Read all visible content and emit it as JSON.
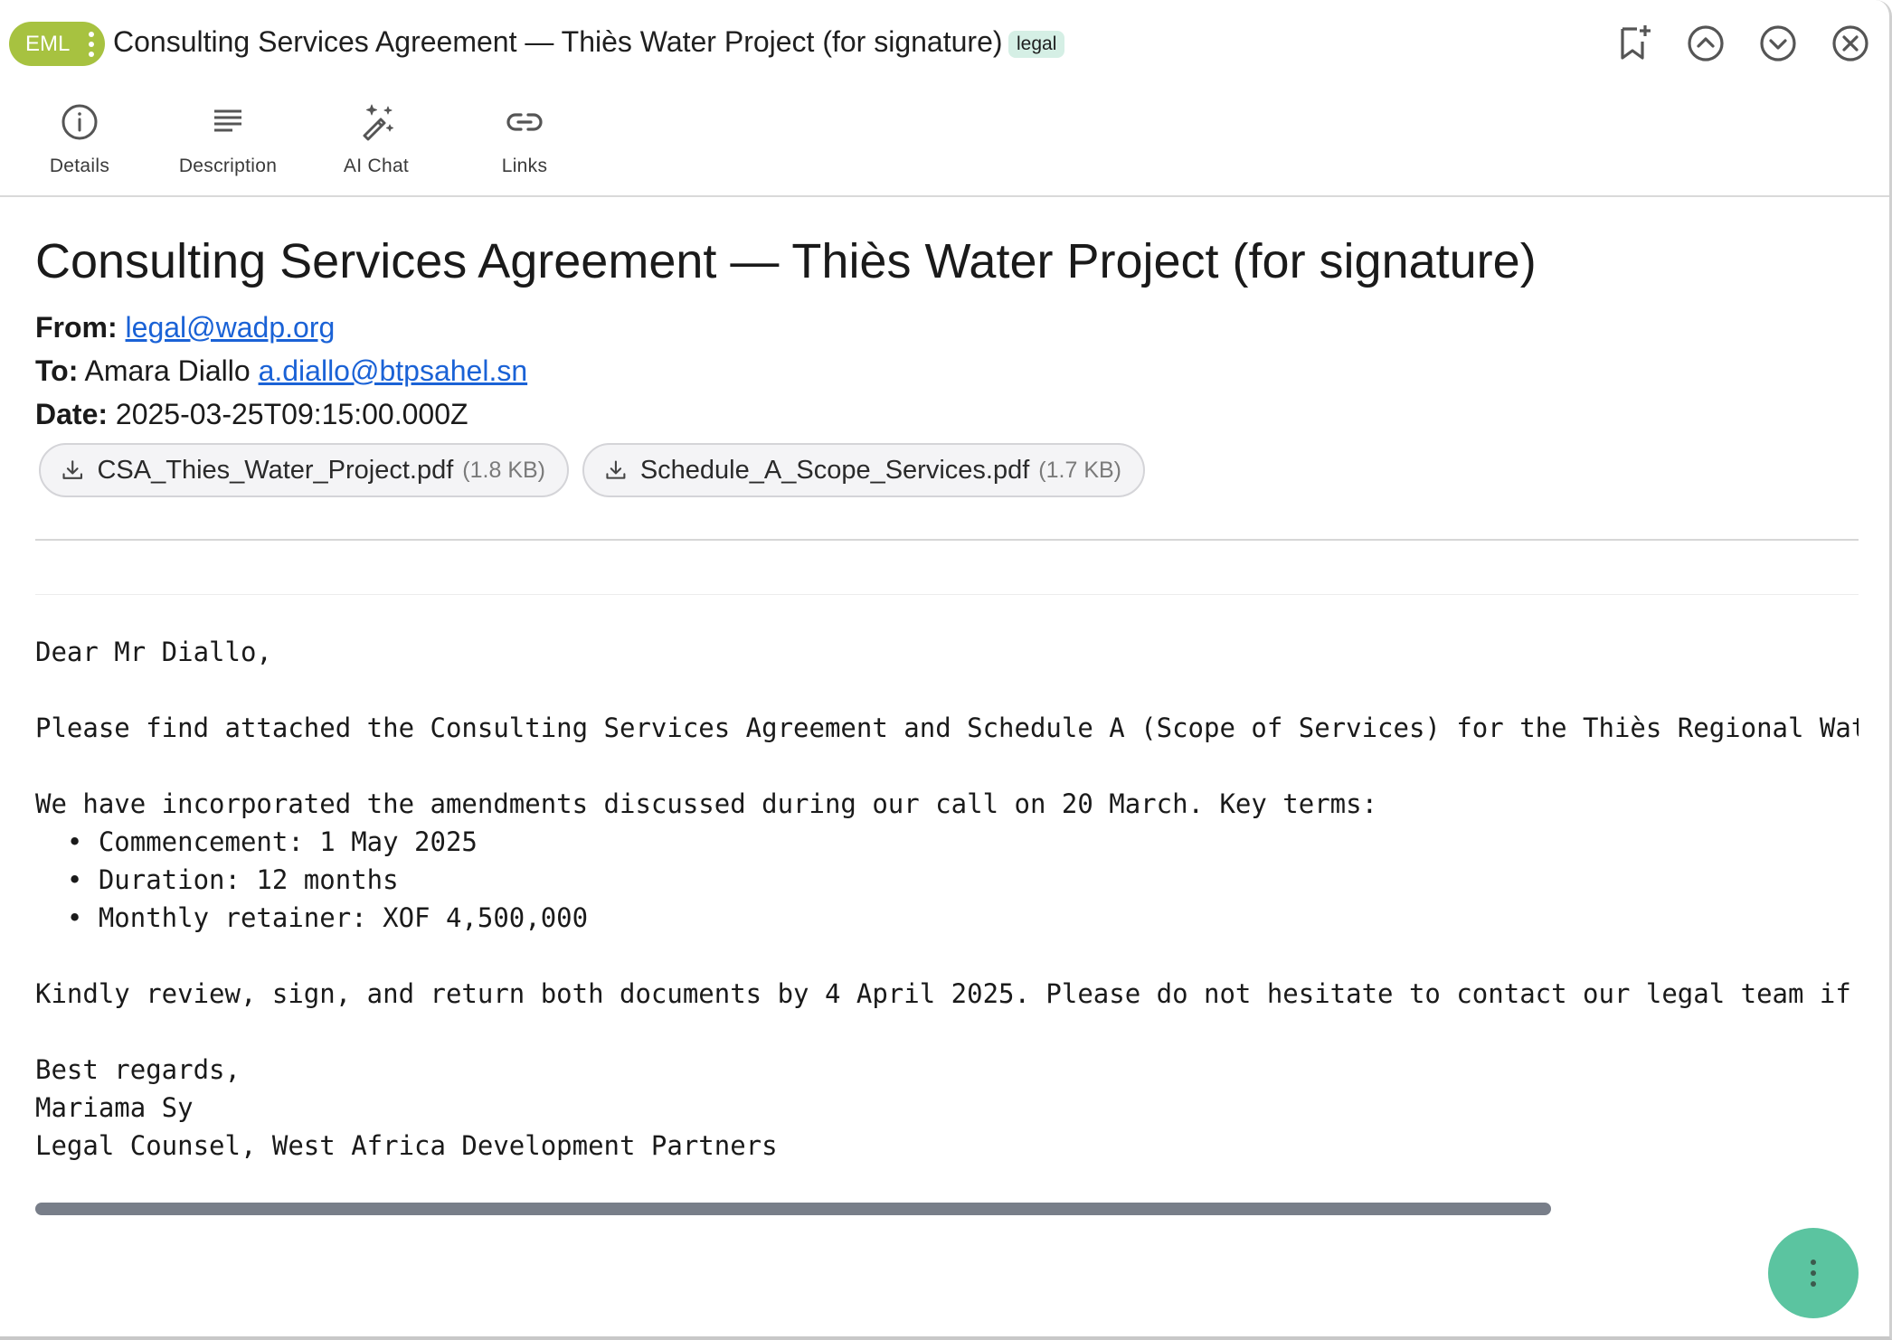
{
  "header": {
    "chip_label": "EML",
    "title": "Consulting Services Agreement — Thiès Water Project (for signature)",
    "tag": "legal"
  },
  "icons": {
    "bookmark_add": "bookmark-add-icon",
    "previous": "chevron-up-circle-icon",
    "next": "chevron-down-circle-icon",
    "close": "close-circle-icon"
  },
  "toolbar": {
    "items": [
      {
        "label": "Details",
        "icon": "info-icon"
      },
      {
        "label": "Description",
        "icon": "description-lines-icon"
      },
      {
        "label": "AI Chat",
        "icon": "magic-wand-icon"
      },
      {
        "label": "Links",
        "icon": "link-icon"
      }
    ]
  },
  "email": {
    "subject": "Consulting Services Agreement — Thiès Water Project (for signature)",
    "from_label": "From:",
    "from_email": "legal@wadp.org",
    "to_label": "To:",
    "to_name": "Amara Diallo",
    "to_email": "a.diallo@btpsahel.sn",
    "date_label": "Date:",
    "date": "2025-03-25T09:15:00.000Z",
    "attachments": [
      {
        "name": "CSA_Thies_Water_Project.pdf",
        "size": "(1.8 KB)"
      },
      {
        "name": "Schedule_A_Scope_Services.pdf",
        "size": "(1.7 KB)"
      }
    ],
    "body_lines": [
      "Dear Mr Diallo,",
      "",
      "Please find attached the Consulting Services Agreement and Schedule A (Scope of Services) for the Thiès Regional Water S",
      "",
      "We have incorporated the amendments discussed during our call on 20 March. Key terms:",
      "  • Commencement: 1 May 2025",
      "  • Duration: 12 months",
      "  • Monthly retainer: XOF 4,500,000",
      "",
      "Kindly review, sign, and return both documents by 4 April 2025. Please do not hesitate to contact our legal team if you",
      "",
      "Best regards,",
      "Mariama Sy",
      "Legal Counsel, West Africa Development Partners"
    ]
  },
  "colors": {
    "chip": "#a7c240",
    "tag_bg": "#d5efe5",
    "link": "#1a62d6",
    "fab": "#5bc4a0",
    "scrollbar": "#787e89"
  }
}
